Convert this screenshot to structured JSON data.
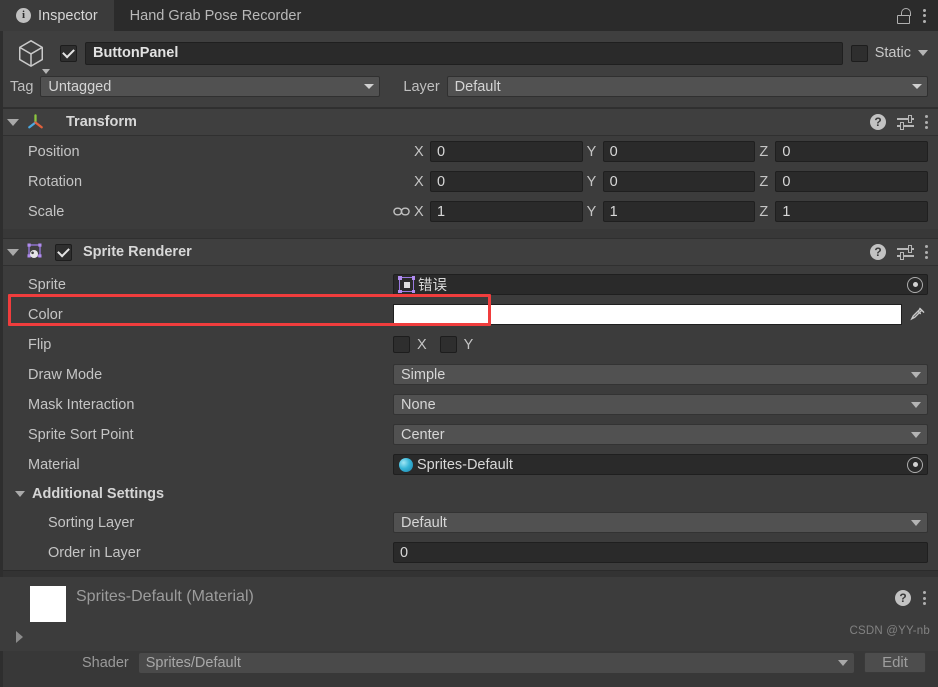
{
  "window": {
    "tabs": [
      {
        "label": "Inspector",
        "icon": "info-icon",
        "active": true
      },
      {
        "label": "Hand Grab Pose Recorder",
        "icon": null,
        "active": false
      }
    ],
    "lock_icon": "lock-open-icon",
    "menu_icon": "kebab-menu-icon"
  },
  "gameobject": {
    "icon": "cube-icon",
    "enabled": true,
    "name": "ButtonPanel",
    "static_label": "Static",
    "static_checked": false,
    "tag_label": "Tag",
    "tag_value": "Untagged",
    "layer_label": "Layer",
    "layer_value": "Default"
  },
  "transform": {
    "title": "Transform",
    "icon": "transform-axis-icon",
    "help_icon": "help-icon",
    "preset_icon": "preset-sliders-icon",
    "menu_icon": "kebab-menu-icon",
    "rows": [
      {
        "label": "Position",
        "x": "0",
        "y": "0",
        "z": "0",
        "link": false
      },
      {
        "label": "Rotation",
        "x": "0",
        "y": "0",
        "z": "0",
        "link": false
      },
      {
        "label": "Scale",
        "x": "1",
        "y": "1",
        "z": "1",
        "link": true
      }
    ],
    "axis_x": "X",
    "axis_y": "Y",
    "axis_z": "Z"
  },
  "sprite_renderer": {
    "title": "Sprite Renderer",
    "icon": "sprite-renderer-icon",
    "enabled": true,
    "help_icon": "help-icon",
    "preset_icon": "preset-sliders-icon",
    "menu_icon": "kebab-menu-icon",
    "sprite": {
      "label": "Sprite",
      "value": "错误",
      "icon": "sprite-asset-icon",
      "picker_icon": "object-picker-icon",
      "highlighted": true,
      "highlight_color": "#f03d3d"
    },
    "color": {
      "label": "Color",
      "swatch_color": "#ffffff",
      "eyedropper_icon": "eyedropper-icon"
    },
    "flip": {
      "label": "Flip",
      "x_label": "X",
      "x_checked": false,
      "y_label": "Y",
      "y_checked": false
    },
    "draw_mode": {
      "label": "Draw Mode",
      "value": "Simple"
    },
    "mask_interaction": {
      "label": "Mask Interaction",
      "value": "None"
    },
    "sprite_sort_point": {
      "label": "Sprite Sort Point",
      "value": "Center"
    },
    "material": {
      "label": "Material",
      "value": "Sprites-Default",
      "icon": "material-sphere-icon",
      "picker_icon": "object-picker-icon"
    },
    "additional_settings": {
      "label": "Additional Settings",
      "sorting_layer": {
        "label": "Sorting Layer",
        "value": "Default"
      },
      "order_in_layer": {
        "label": "Order in Layer",
        "value": "0"
      }
    }
  },
  "material_preview": {
    "title": "Sprites-Default (Material)",
    "thumb_color": "#ffffff",
    "shader_label": "Shader",
    "shader_value": "Sprites/Default",
    "edit_label": "Edit",
    "help_icon": "help-icon",
    "menu_icon": "kebab-menu-icon",
    "foldout_icon": "foldout-collapsed-icon"
  },
  "watermark": {
    "text": "CSDN @YY-nb"
  }
}
